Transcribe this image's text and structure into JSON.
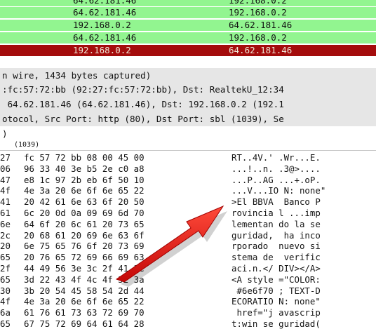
{
  "colors": {
    "row_green": "#92f590",
    "row_selected": "#a40c0c",
    "row_selected_text": "#f0e8d8",
    "detail_gray": "#e6e6e6",
    "arrow_red": "#e31515"
  },
  "packet_rows": [
    {
      "src": "64.62.181.46",
      "dst": "192.168.0.2"
    },
    {
      "src": "64.62.181.46",
      "dst": "192.168.0.2"
    },
    {
      "src": "192.168.0.2",
      "dst": "64.62.181.46"
    },
    {
      "src": "64.62.181.46",
      "dst": "192.168.0.2"
    },
    {
      "src": "192.168.0.2",
      "dst": "64.62.181.46",
      "selected": true
    }
  ],
  "detail_rows": [
    "n wire, 1434 bytes captured)",
    ":fc:57:72:bb (92:27:fc:57:72:bb), Dst: RealtekU_12:34",
    " 64.62.181.46 (64.62.181.46), Dst: 192.168.0.2 (192.1",
    "otocol, Src Port: http (80), Dst Port: sbl (1039), Se",
    ")",
    "(1039)"
  ],
  "hex_rows": [
    {
      "off": "27",
      "hex": "fc 57 72 bb 08 00 45 00",
      "ascii": "RT..4V.' .Wr...E."
    },
    {
      "off": "06",
      "hex": "96 33 40 3e b5 2e c0 a8",
      "ascii": "...!..n. .3@>...."
    },
    {
      "off": "47",
      "hex": "e8 1c 97 2b eb 6f 50 10",
      "ascii": "...P..AG ...+.oP."
    },
    {
      "off": "4f",
      "hex": "4e 3a 20 6e 6f 6e 65 22",
      "ascii": "...V...IO N: none\""
    },
    {
      "off": "41",
      "hex": "20 42 61 6e 63 6f 20 50",
      "ascii": ">El BBVA  Banco P"
    },
    {
      "off": "61",
      "hex": "6c 20 0d 0a 09 69 6d 70",
      "ascii": "rovincia l ...imp"
    },
    {
      "off": "6e",
      "hex": "64 6f 20 6c 61 20 73 65",
      "ascii": "lementan do la se"
    },
    {
      "off": "2c",
      "hex": "20 68 61 20 69 6e 63 6f",
      "ascii": "guridad,  ha inco"
    },
    {
      "off": "20",
      "hex": "6e 75 65 76 6f 20 73 69",
      "ascii": "rporado  nuevo si"
    },
    {
      "off": "65",
      "hex": "20 76 65 72 69 66 69 63",
      "ascii": "stema de  verific"
    },
    {
      "off": "2f",
      "hex": "44 49 56 3e 3c 2f 41 3e",
      "ascii": "aci.n.</ DIV></A>"
    },
    {
      "off": "65",
      "hex": "3d 22 43 4f 4c 4f 52 3a",
      "ascii": "<A style =\"COLOR:"
    },
    {
      "off": "30",
      "hex": "3b 20 54 45 58 54 2d 44",
      "ascii": " #6e6f70 ; TEXT-D"
    },
    {
      "off": "4f",
      "hex": "4e 3a 20 6e 6f 6e 65 22",
      "ascii": "ECORATIO N: none\""
    },
    {
      "off": "6a",
      "hex": "61 76 61 73 63 72 69 70",
      "ascii": " href=\"j avascrip"
    },
    {
      "off": "65",
      "hex": "67 75 72 69 64 61 64 28",
      "ascii": "t:win se guridad("
    }
  ]
}
